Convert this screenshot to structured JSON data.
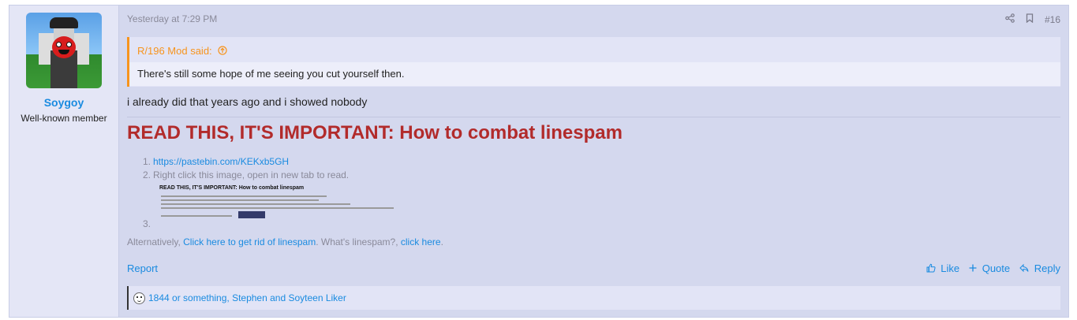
{
  "post": {
    "author": {
      "name": "Soygoy",
      "title": "Well-known member"
    },
    "timestamp": "Yesterday at 7:29 PM",
    "post_number": "#16",
    "quote": {
      "author_line": "R/196 Mod said:",
      "text": "There's still some hope of me seeing you cut yourself then."
    },
    "body": "i already did that years ago and i showed nobody",
    "signature": {
      "title": "READ THIS, IT'S IMPORTANT: How to combat linespam",
      "items": [
        {
          "num": "1.",
          "link": "https://pastebin.com/KEKxb5GH"
        },
        {
          "num": "2.",
          "text": "Right click this image, open in new tab to read."
        },
        {
          "num": "3.",
          "image_title": "READ THIS, IT'S IMPORTANT: How to combat linespam"
        }
      ],
      "alt_prefix": "Alternatively, ",
      "alt_link": "Click here to get rid of linespam",
      "alt_middle": ". What's linespam?, ",
      "alt_link2": "click here",
      "alt_suffix": "."
    },
    "actions": {
      "report": "Report",
      "like": "Like",
      "quote": "Quote",
      "reply": "Reply"
    },
    "reactions_text": "1844 or something, Stephen and Soyteen Liker"
  },
  "colors": {
    "link": "#1a8be0",
    "quote_accent": "#f7941d",
    "signature_title": "#b22b2b"
  },
  "icons": [
    "share-icon",
    "bookmark-icon",
    "arrow-up-circle-icon",
    "thumbs-up-icon",
    "plus-icon",
    "reply-icon",
    "reaction-face-icon"
  ]
}
